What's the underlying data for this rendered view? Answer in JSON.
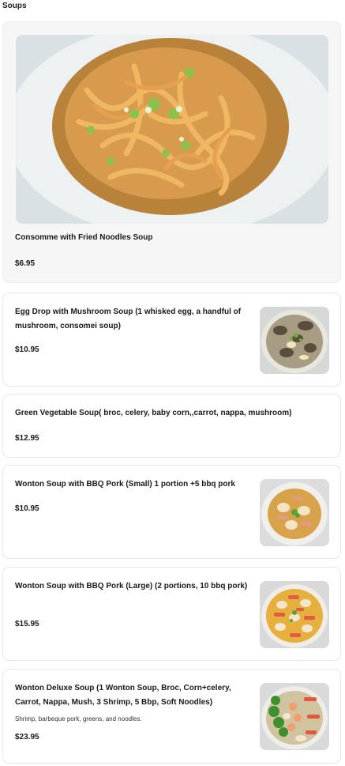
{
  "section": {
    "title": "Soups"
  },
  "items": [
    {
      "name": "Consomme with Fried Noodles Soup",
      "price": "$6.95",
      "image": "fried-noodle-soup-photo"
    },
    {
      "name": "Egg Drop with Mushroom Soup (1 whisked egg, a handful of mushroom, consomei soup)",
      "price": "$10.95",
      "image": "mushroom-soup-photo"
    },
    {
      "name": "Green Vegetable Soup( broc, celery, baby corn,,carrot, nappa, mushroom)",
      "price": "$12.95"
    },
    {
      "name": "Wonton Soup with BBQ Pork (Small) 1 portion +5 bbq pork",
      "price": "$10.95",
      "image": "wonton-soup-small-photo"
    },
    {
      "name": "Wonton Soup with BBQ Pork (Large) (2 portions, 10 bbq pork)",
      "price": "$15.95",
      "image": "wonton-soup-large-photo"
    },
    {
      "name": "Wonton Deluxe Soup (1 Wonton Soup, Broc, Corn+celery, Carrot, Nappa, Mush, 3 Shrimp, 5 Bbp, Soft Noodles)",
      "description": "Shrimp, barbeque pork, greens, and noodles.",
      "price": "$23.95",
      "image": "wonton-deluxe-soup-photo"
    }
  ]
}
